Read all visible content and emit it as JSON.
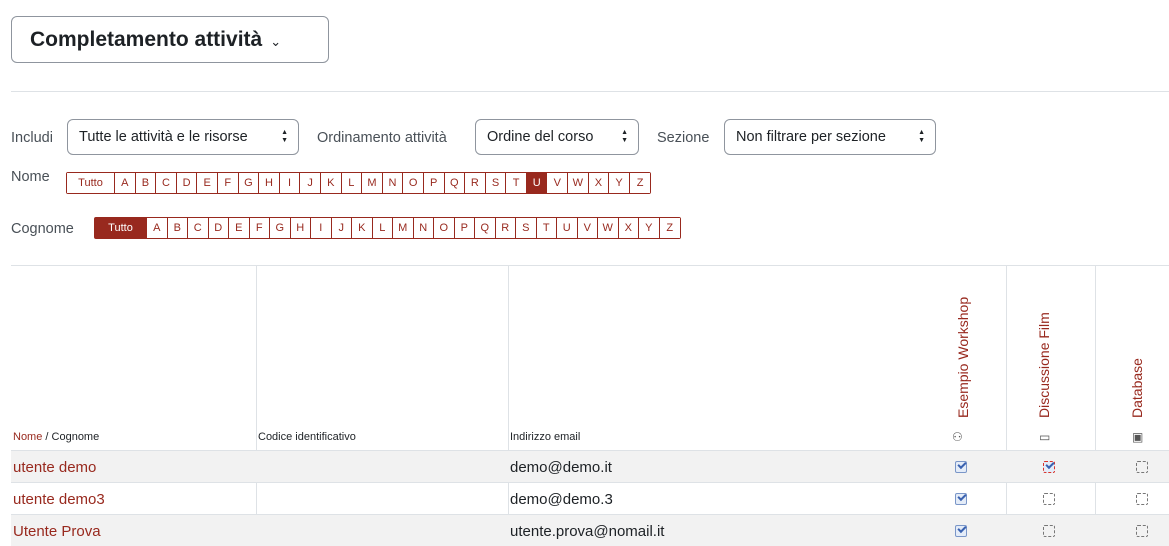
{
  "header": {
    "title": "Completamento attività",
    "chevron": "⌄"
  },
  "filters": {
    "include_label": "Includi",
    "include_value": "Tutte le attività e le risorse",
    "order_label": "Ordinamento attività",
    "order_value": "Ordine del corso",
    "section_label": "Sezione",
    "section_value": "Non filtrare per sezione",
    "select_arrow_up": "▲",
    "select_arrow_down": "▼"
  },
  "name_filter": {
    "label": "Nome",
    "letters": [
      "Tutto",
      "A",
      "B",
      "C",
      "D",
      "E",
      "F",
      "G",
      "H",
      "I",
      "J",
      "K",
      "L",
      "M",
      "N",
      "O",
      "P",
      "Q",
      "R",
      "S",
      "T",
      "U",
      "V",
      "W",
      "X",
      "Y",
      "Z"
    ],
    "selected": "U"
  },
  "surname_filter": {
    "label": "Cognome",
    "letters": [
      "Tutto",
      "A",
      "B",
      "C",
      "D",
      "E",
      "F",
      "G",
      "H",
      "I",
      "J",
      "K",
      "L",
      "M",
      "N",
      "O",
      "P",
      "Q",
      "R",
      "S",
      "T",
      "U",
      "V",
      "W",
      "X",
      "Y",
      "Z"
    ],
    "selected": "Tutto"
  },
  "table": {
    "col_name_first": "Nome",
    "col_name_sep": " / ",
    "col_name_last": "Cognome",
    "col_idnumber": "Codice identificativo",
    "col_email": "Indirizzo email",
    "activities": [
      {
        "name": "Esempio Workshop",
        "icon": "workshop-icon",
        "glyph": "⚇"
      },
      {
        "name": "Discussione Film",
        "icon": "forum-icon",
        "glyph": "▭"
      },
      {
        "name": "Database",
        "icon": "database-icon",
        "glyph": "▣"
      }
    ],
    "rows": [
      {
        "name": "utente demo",
        "idnumber": "",
        "email": "demo@demo.it",
        "status": [
          "done",
          "flag",
          "none"
        ]
      },
      {
        "name": "utente demo3",
        "idnumber": "",
        "email": "demo@demo.3",
        "status": [
          "done",
          "none",
          "none"
        ]
      },
      {
        "name": "Utente Prova",
        "idnumber": "",
        "email": "utente.prova@nomail.it",
        "status": [
          "done",
          "none",
          "none"
        ]
      }
    ]
  }
}
